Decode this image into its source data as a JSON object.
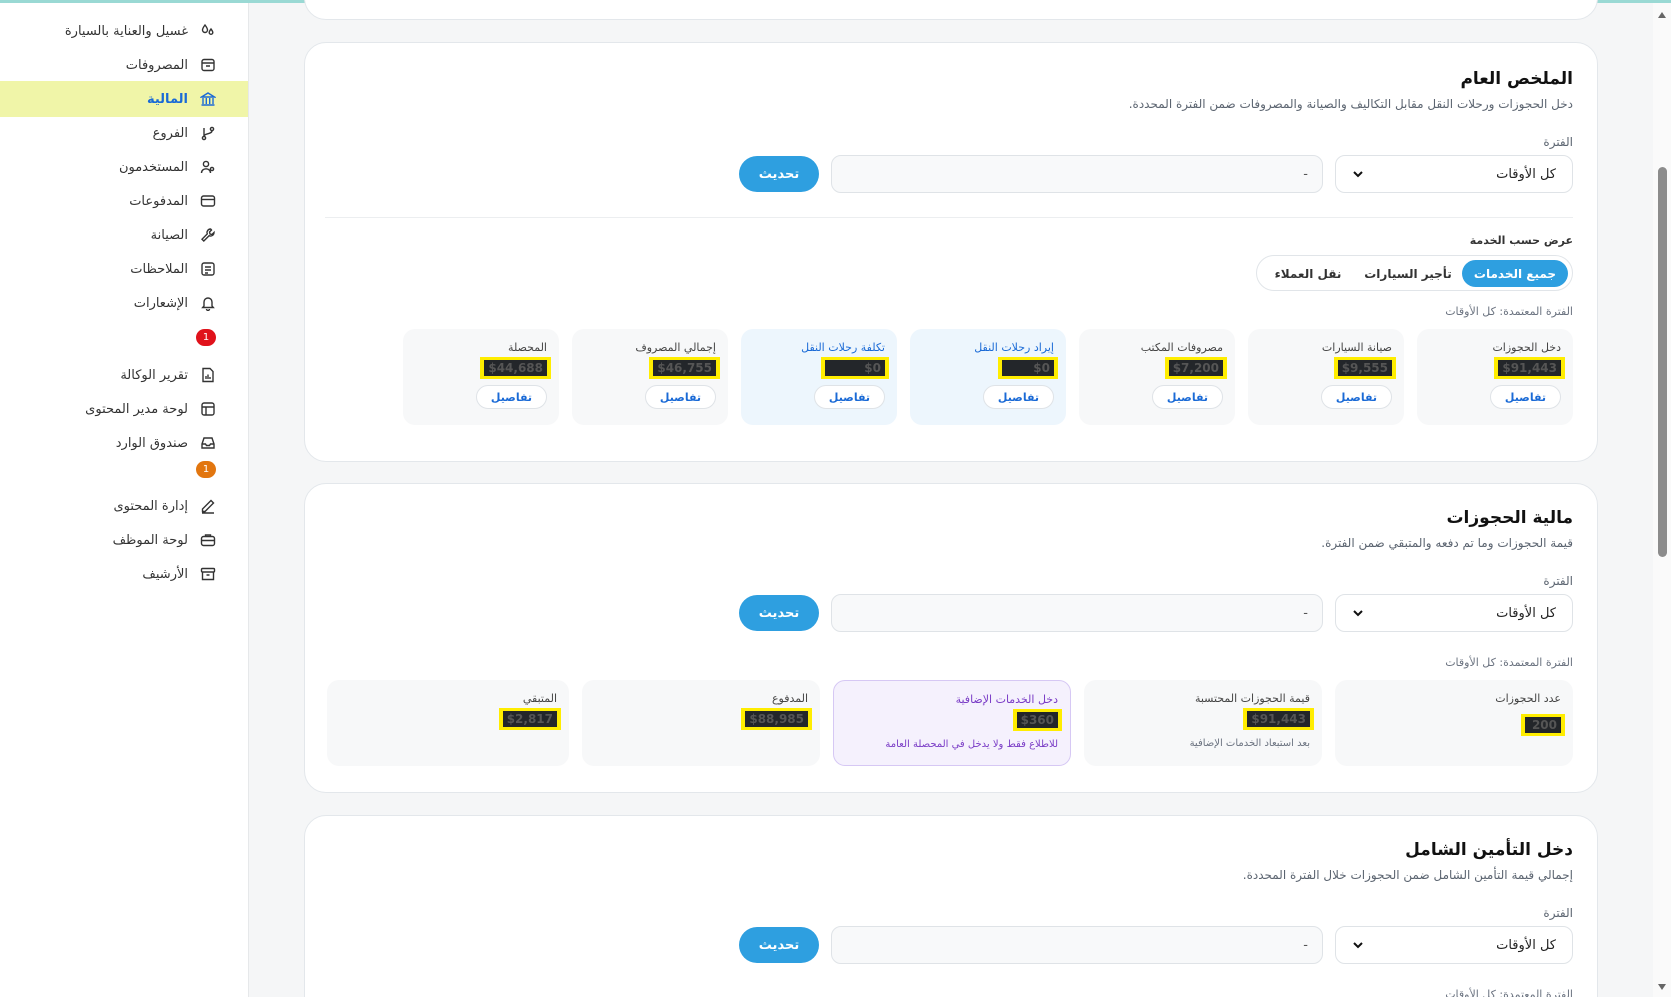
{
  "sidebar": {
    "items": [
      {
        "label": "غسيل والعناية بالسيارة",
        "icon": "car-wash-icon"
      },
      {
        "label": "المصروفات",
        "icon": "receipt-icon"
      },
      {
        "label": "المالية",
        "icon": "bank-icon",
        "active": true
      },
      {
        "label": "الفروع",
        "icon": "branch-icon"
      },
      {
        "label": "المستخدمون",
        "icon": "users-icon"
      },
      {
        "label": "المدفوعات",
        "icon": "credit-card-icon"
      },
      {
        "label": "الصيانة",
        "icon": "wrench-icon"
      },
      {
        "label": "الملاحظات",
        "icon": "notes-icon"
      },
      {
        "label": "الإشعارات",
        "icon": "bell-icon",
        "badge": "1"
      },
      {
        "label": "تقرير الوكالة",
        "icon": "report-icon"
      },
      {
        "label": "لوحة مدير المحتوى",
        "icon": "layout-icon"
      },
      {
        "label": "صندوق الوارد",
        "icon": "inbox-icon",
        "badge": "1"
      },
      {
        "label": "إدارة المحتوى",
        "icon": "pen-icon"
      },
      {
        "label": "لوحة الموظف",
        "icon": "briefcase-icon"
      },
      {
        "label": "الأرشيف",
        "icon": "archive-icon"
      }
    ]
  },
  "summary": {
    "title": "الملخص العام",
    "subtitle": "دخل الحجوزات ورحلات النقل مقابل التكاليف والصيانة والمصروفات ضمن الفترة المحددة.",
    "period_label": "الفترة",
    "period_value": "كل الأوقات",
    "range_value": "-",
    "refresh": "تحديث",
    "view_by_label": "عرض حسب الخدمة",
    "tabs": [
      "جميع الخدمات",
      "تأجير السيارات",
      "نقل العملاء"
    ],
    "applied_period": "الفترة المعتمدة: كل الأوقات",
    "details": "تفاصيل",
    "stats": [
      {
        "label": "دخل الحجوزات",
        "value": "$91,443"
      },
      {
        "label": "صيانة السيارات",
        "value": "$9,555"
      },
      {
        "label": "مصروفات المكتب",
        "value": "$7,200"
      },
      {
        "label": "إيراد رحلات النقل",
        "value": "$0"
      },
      {
        "label": "تكلفة رحلات النقل",
        "value": "$0"
      },
      {
        "label": "إجمالي المصروف",
        "value": "$46,755"
      },
      {
        "label": "المحصلة",
        "value": "$44,688"
      }
    ]
  },
  "bookings": {
    "title": "مالية الحجوزات",
    "subtitle": "قيمة الحجوزات وما تم دفعه والمتبقي ضمن الفترة.",
    "period_label": "الفترة",
    "period_value": "كل الأوقات",
    "range_value": "-",
    "refresh": "تحديث",
    "applied_period": "الفترة المعتمدة: كل الأوقات",
    "stats": [
      {
        "label": "عدد الحجوزات",
        "value": "200"
      },
      {
        "label": "قيمة الحجوزات المحتسبة",
        "value": "$91,443",
        "note": "بعد استبعاد الخدمات الإضافية"
      },
      {
        "label": "دخل الخدمات الإضافية",
        "value": "$360",
        "note": "للاطلاع فقط ولا يدخل في المحصلة العامة"
      },
      {
        "label": "المدفوع",
        "value": "$88,985"
      },
      {
        "label": "المتبقي",
        "value": "$2,817"
      }
    ]
  },
  "insurance": {
    "title": "دخل التأمين الشامل",
    "subtitle": "إجمالي قيمة التأمين الشامل ضمن الحجوزات خلال الفترة المحددة.",
    "period_label": "الفترة",
    "period_value": "كل الأوقات",
    "range_value": "-",
    "refresh": "تحديث",
    "applied_period": "الفترة المعتمدة: كل الأوقات"
  },
  "colors": {
    "accent": "#2e9fe0",
    "active_nav_bg": "#f0f5a8",
    "badge_red": "#e0121b",
    "badge_orange": "#e2760f"
  }
}
